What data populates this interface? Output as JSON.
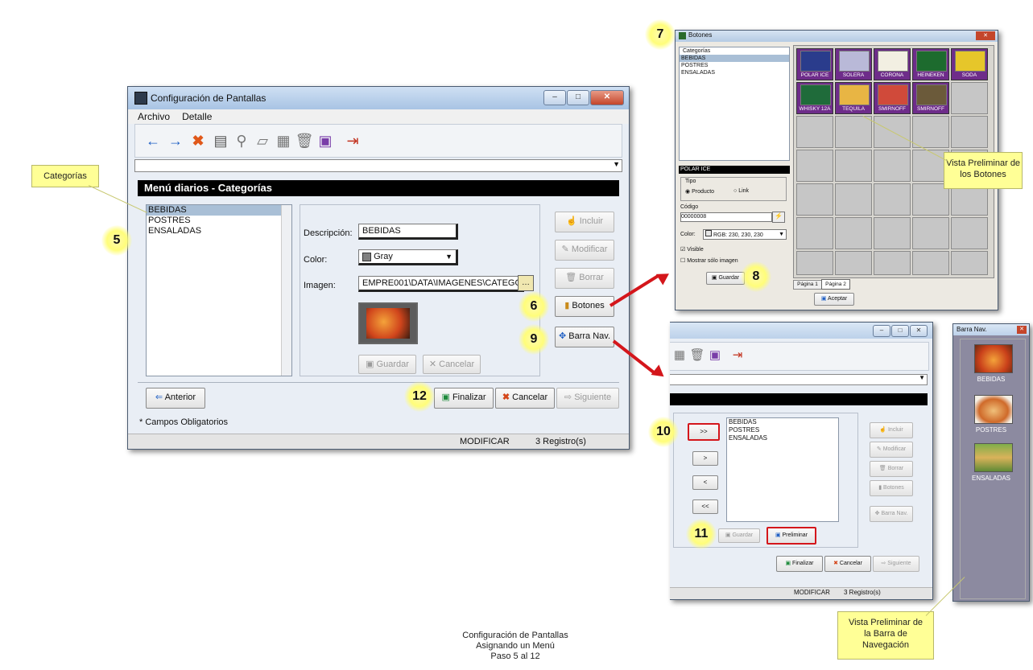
{
  "main_window": {
    "title": "Configuración de Pantallas",
    "menu": [
      "Archivo",
      "Detalle"
    ],
    "section_header": "Menú diarios - Categorías",
    "list_items": [
      "BEBIDAS",
      "POSTRES",
      "ENSALADAS"
    ],
    "descripcion_label": "Descripción:",
    "descripcion_value": "BEBIDAS",
    "color_label": "Color:",
    "color_value": "Gray",
    "imagen_label": "Imagen:",
    "imagen_value": "EMPRE001\\DATA\\IMAGENES\\CATEGO",
    "buttons": {
      "incluir": "Incluir",
      "modificar": "Modificar",
      "borrar": "Borrar",
      "botones": "Botones",
      "barra_nav": "Barra Nav.",
      "guardar": "Guardar",
      "cancelar": "Cancelar",
      "anterior": "Anterior",
      "finalizar": "Finalizar",
      "cancelar2": "Cancelar",
      "siguiente": "Siguiente"
    },
    "required_note": "* Campos Obligatorios",
    "status_mode": "MODIFICAR",
    "status_count": "3 Registro(s)"
  },
  "botones_window": {
    "title": "Botones",
    "categorias_label": "Categorías",
    "categorias": [
      "BEBIDAS",
      "POSTRES",
      "ENSALADAS"
    ],
    "selected_name": "POLAR ICE",
    "tipo_label": "Tipo",
    "producto_label": "Producto",
    "link_label": "Link",
    "codigo_label": "Código",
    "codigo_value": "00000008",
    "color_label": "Color:",
    "color_value": "RGB: 230, 230, 230",
    "visible_label": "Visible",
    "mostrar_label": "Mostrar sólo imagen",
    "guardar": "Guardar",
    "tab1": "Página 1",
    "tab2": "Página 2",
    "aceptar": "Aceptar",
    "products": [
      "POLAR ICE",
      "SOLERA",
      "CORONA",
      "HEINEKEN",
      "SODA",
      "WHISKY 12A",
      "TEQUILA",
      "SMIRNOFF",
      "SMIRNOFF"
    ],
    "product_colors": [
      "#2a3c8c",
      "#b9b9d8",
      "#f2efe2",
      "#1d6b2e",
      "#e6c62a",
      "#1f6b3a",
      "#e8b544",
      "#d04a3a",
      "#6b5a3a"
    ]
  },
  "barra_window": {
    "list_items": [
      "BEBIDAS",
      "POSTRES",
      "ENSALADAS"
    ],
    "move_buttons": [
      ">>",
      ">",
      "<",
      "<<"
    ],
    "incluir": "Incluir",
    "modificar": "Modificar",
    "borrar": "Borrar",
    "botones": "Botones",
    "barra_nav": "Barra Nav.",
    "guardar": "Guardar",
    "preliminar": "Preliminar",
    "finalizar": "Finalizar",
    "cancelar": "Cancelar",
    "siguiente": "Siguiente",
    "status_mode": "MODIFICAR",
    "status_count": "3 Registro(s)"
  },
  "nav_preview": {
    "title": "Barra Nav.",
    "items": [
      "BEBIDAS",
      "POSTRES",
      "ENSALADAS"
    ]
  },
  "callouts": {
    "categorias": "Categorías",
    "vista_botones_1": "Vista Preliminar de",
    "vista_botones_2": "los Botones",
    "vista_barra_1": "Vista Preliminar de",
    "vista_barra_2": "la Barra de",
    "vista_barra_3": "Navegación"
  },
  "steps": [
    "5",
    "6",
    "7",
    "8",
    "9",
    "10",
    "11",
    "12"
  ],
  "caption": {
    "line1": "Configuración de Pantallas",
    "line2": "Asignando un Menú",
    "line3": "Paso 5 al 12"
  },
  "colors": {
    "arrow": "#d4161b",
    "callout_bg": "#ffff96",
    "highlight_circle": "#fffd7a",
    "nav_panel": "#8c8aa0"
  }
}
